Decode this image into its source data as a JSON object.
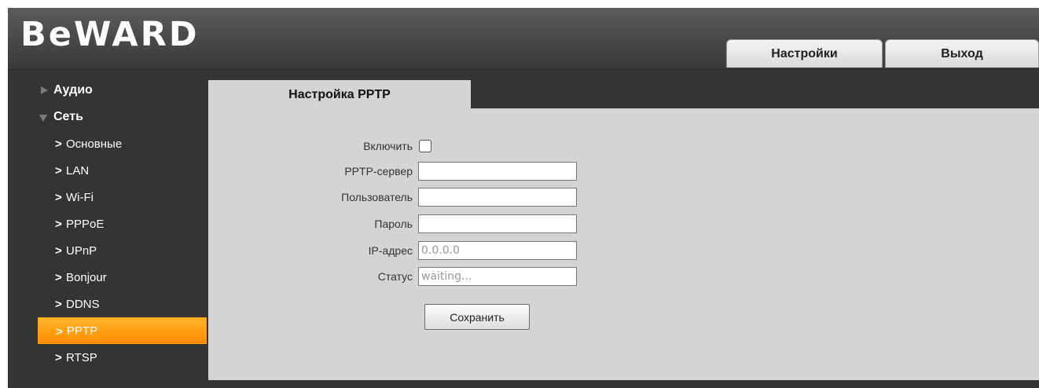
{
  "app": {
    "logo": "BeWARD"
  },
  "header": {
    "tabs": [
      {
        "label": "Настройки"
      },
      {
        "label": "Выход"
      }
    ]
  },
  "sidebar": {
    "groups": [
      {
        "label": "Аудио",
        "expanded": false
      },
      {
        "label": "Сеть",
        "expanded": true
      }
    ],
    "chevron": ">",
    "items": [
      {
        "label": "Основные"
      },
      {
        "label": "LAN"
      },
      {
        "label": "Wi-Fi"
      },
      {
        "label": "PPPoE"
      },
      {
        "label": "UPnP"
      },
      {
        "label": "Bonjour"
      },
      {
        "label": "DDNS"
      },
      {
        "label": "PPTP",
        "active": true
      },
      {
        "label": "RTSP"
      }
    ]
  },
  "content": {
    "tab_title": "Настройка PPTP",
    "form": {
      "enable_label": "Включить",
      "enable_checked": false,
      "server_label": "PPTP-сервер",
      "server_value": "",
      "user_label": "Пользователь",
      "user_value": "",
      "password_label": "Пароль",
      "password_value": "",
      "ip_label": "IP-адрес",
      "ip_value": "0.0.0.0",
      "status_label": "Статус",
      "status_value": "waiting...",
      "save_label": "Сохранить"
    }
  },
  "colors": {
    "active_item": "#ff9d14",
    "panel": "#d4d4d4",
    "background": "#343434"
  }
}
